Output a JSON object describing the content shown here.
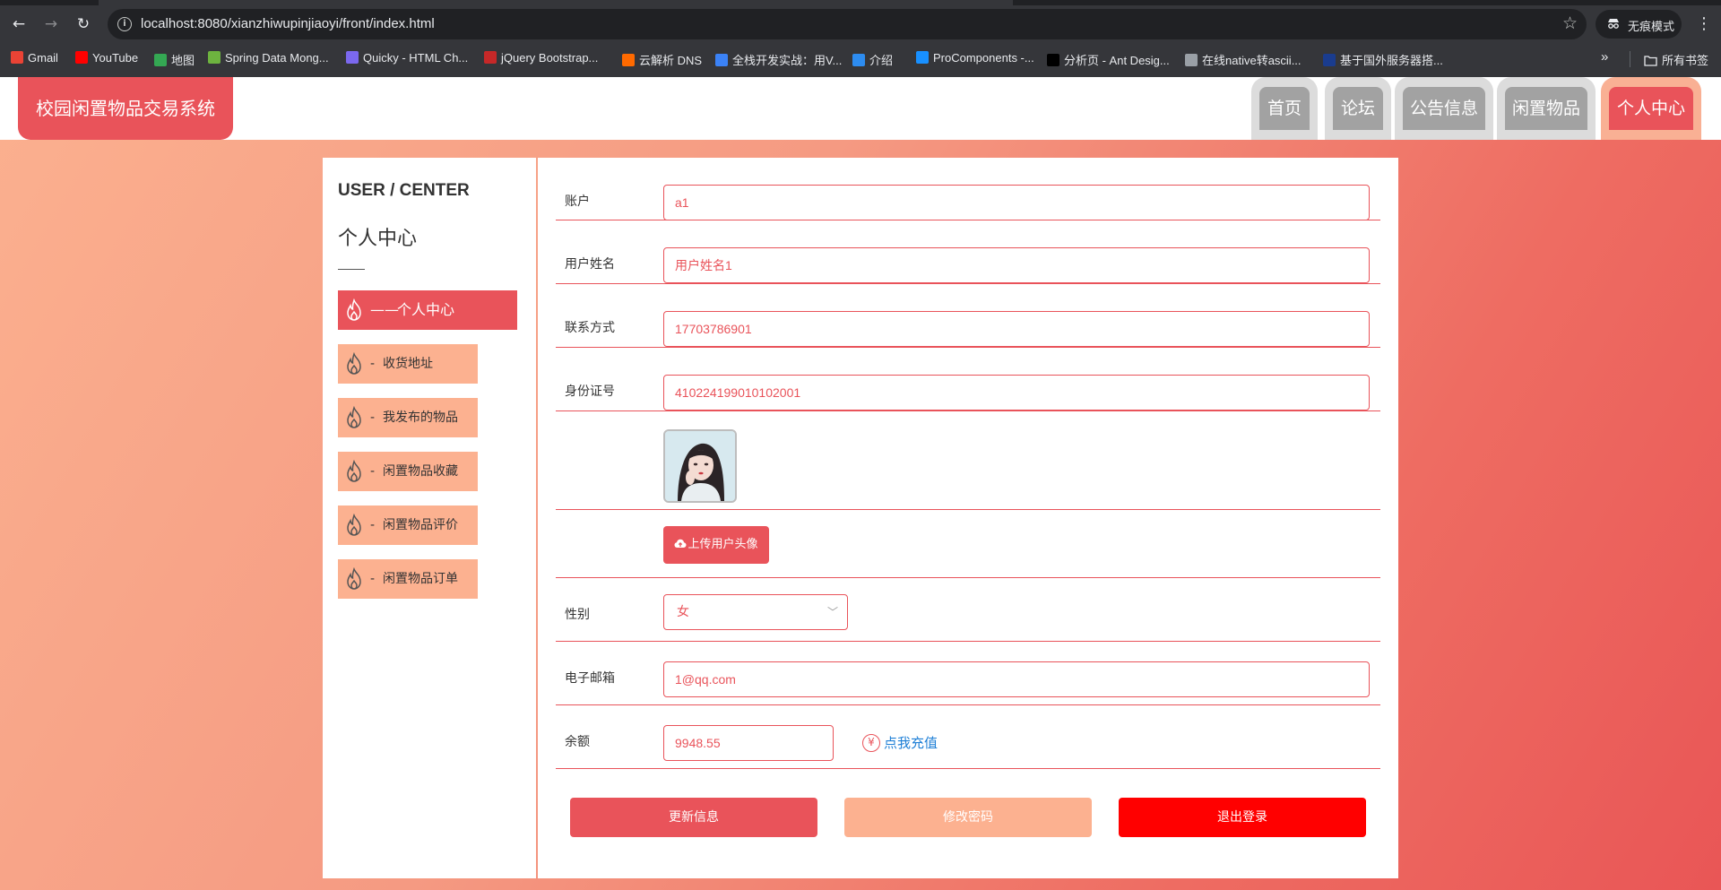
{
  "browser": {
    "url": "localhost:8080/xianzhiwupinjiaoyi/front/index.html",
    "incognito_label": "无痕模式",
    "bookmarks": [
      {
        "label": "Gmail",
        "icon": "gmail-icon",
        "color": "#ea4335"
      },
      {
        "label": "YouTube",
        "icon": "youtube-icon",
        "color": "#ff0000"
      },
      {
        "label": "地图",
        "icon": "maps-icon",
        "color": "#34a853"
      },
      {
        "label": "Spring Data Mong...",
        "icon": "spring-icon",
        "color": "#6db33f"
      },
      {
        "label": "Quicky - HTML Ch...",
        "icon": "quicky-icon",
        "color": "#7b68ee"
      },
      {
        "label": "jQuery Bootstrap...",
        "icon": "jquery-icon",
        "color": "#c62828"
      },
      {
        "label": "云解析 DNS",
        "icon": "aliyun-icon",
        "color": "#ff6a00"
      },
      {
        "label": "全栈开发实战：用V...",
        "icon": "bookmark-m-icon",
        "color": "#3b82f6"
      },
      {
        "label": "介绍",
        "icon": "globe-blue-icon",
        "color": "#2d8cf0"
      },
      {
        "label": "ProComponents -...",
        "icon": "procomponents-icon",
        "color": "#1890ff"
      },
      {
        "label": "分析页 - Ant Desig...",
        "icon": "pro-icon",
        "color": "#000000"
      },
      {
        "label": "在线native转ascii...",
        "icon": "globe-icon",
        "color": "#9aa0a6"
      },
      {
        "label": "基于国外服务器搭...",
        "icon": "flag-icon",
        "color": "#1a3c8e"
      }
    ],
    "all_bookmarks_label": "所有书签"
  },
  "site": {
    "brand": "校园闲置物品交易系统",
    "nav": [
      {
        "label": "首页",
        "active": false
      },
      {
        "label": "论坛",
        "active": false
      },
      {
        "label": "公告信息",
        "active": false
      },
      {
        "label": "闲置物品",
        "active": false
      },
      {
        "label": "个人中心",
        "active": true
      }
    ]
  },
  "sidebar": {
    "title_en": "USER / CENTER",
    "title_cn": "个人中心",
    "items": [
      {
        "label": "个人中心",
        "dash": "——",
        "active": true
      },
      {
        "label": "收货地址",
        "dash": "-",
        "active": false
      },
      {
        "label": "我发布的物品",
        "dash": "-",
        "active": false
      },
      {
        "label": "闲置物品收藏",
        "dash": "-",
        "active": false
      },
      {
        "label": "闲置物品评价",
        "dash": "-",
        "active": false
      },
      {
        "label": "闲置物品订单",
        "dash": "-",
        "active": false
      }
    ]
  },
  "form": {
    "account": {
      "label": "账户",
      "value": "a1"
    },
    "name": {
      "label": "用户姓名",
      "value": "用户姓名1"
    },
    "phone": {
      "label": "联系方式",
      "value": "17703786901"
    },
    "id_card": {
      "label": "身份证号",
      "value": "410224199010102001"
    },
    "upload_label": "上传用户头像",
    "gender": {
      "label": "性别",
      "value": "女"
    },
    "email": {
      "label": "电子邮箱",
      "value": "1@qq.com"
    },
    "balance": {
      "label": "余额",
      "value": "9948.55",
      "recharge_label": "点我充值",
      "yen": "¥"
    }
  },
  "actions": {
    "update": "更新信息",
    "change_password": "修改密码",
    "logout": "退出登录"
  },
  "colors": {
    "accent": "#e9535a",
    "peach": "#fcb190",
    "logout": "#ff0000",
    "link": "#1e7fd6"
  }
}
